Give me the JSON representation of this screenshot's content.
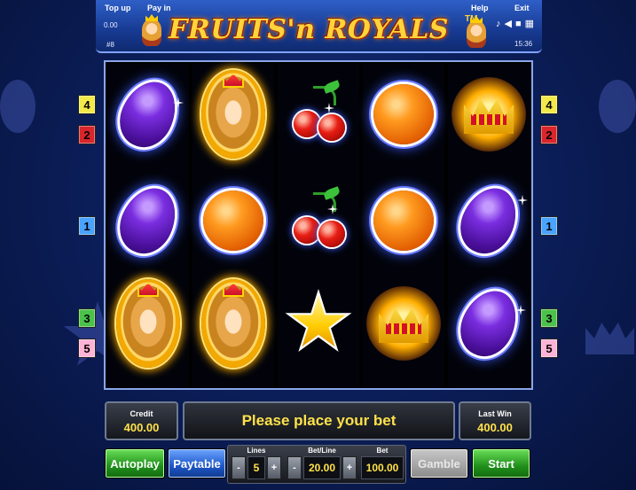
{
  "header": {
    "top_up_label": "Top up",
    "pay_in_label": "Pay in",
    "top_up_value": "0.00",
    "session_id": "#8",
    "title": "FRUITS'n ROYALS",
    "tm": "TM",
    "help_label": "Help",
    "exit_label": "Exit",
    "clock": "15:36",
    "icons": [
      "music-icon",
      "sound-icon",
      "fullscreen-icon",
      "settings-icon"
    ]
  },
  "reels": [
    [
      "plum",
      "plum",
      "queen"
    ],
    [
      "queen",
      "orange",
      "queen"
    ],
    [
      "cherry",
      "cherry",
      "star"
    ],
    [
      "orange",
      "orange",
      "crown"
    ],
    [
      "crown",
      "plum",
      "plum"
    ]
  ],
  "line_badges": {
    "left": [
      {
        "label": "4",
        "color": "yellow"
      },
      {
        "label": "2",
        "color": "red"
      },
      {
        "label": "1",
        "color": "blue"
      },
      {
        "label": "3",
        "color": "green"
      },
      {
        "label": "5",
        "color": "pink"
      }
    ],
    "right": [
      {
        "label": "4",
        "color": "yellow"
      },
      {
        "label": "2",
        "color": "red"
      },
      {
        "label": "1",
        "color": "blue"
      },
      {
        "label": "3",
        "color": "green"
      },
      {
        "label": "5",
        "color": "pink"
      }
    ]
  },
  "info": {
    "credit_label": "Credit",
    "credit_value": "400.00",
    "message": "Please place your bet",
    "last_win_label": "Last Win",
    "last_win_value": "400.00"
  },
  "controls": {
    "autoplay_label": "Autoplay",
    "paytable_label": "Paytable",
    "lines_label": "Lines",
    "lines_value": "5",
    "bet_line_label": "Bet/Line",
    "bet_line_value": "20.00",
    "bet_label": "Bet",
    "bet_value": "100.00",
    "gamble_label": "Gamble",
    "start_label": "Start",
    "minus": "-",
    "plus": "+"
  },
  "colors": {
    "accent_yellow": "#ffe14a",
    "start_green": "#1f8f1a",
    "paytable_blue": "#1d56c8"
  }
}
